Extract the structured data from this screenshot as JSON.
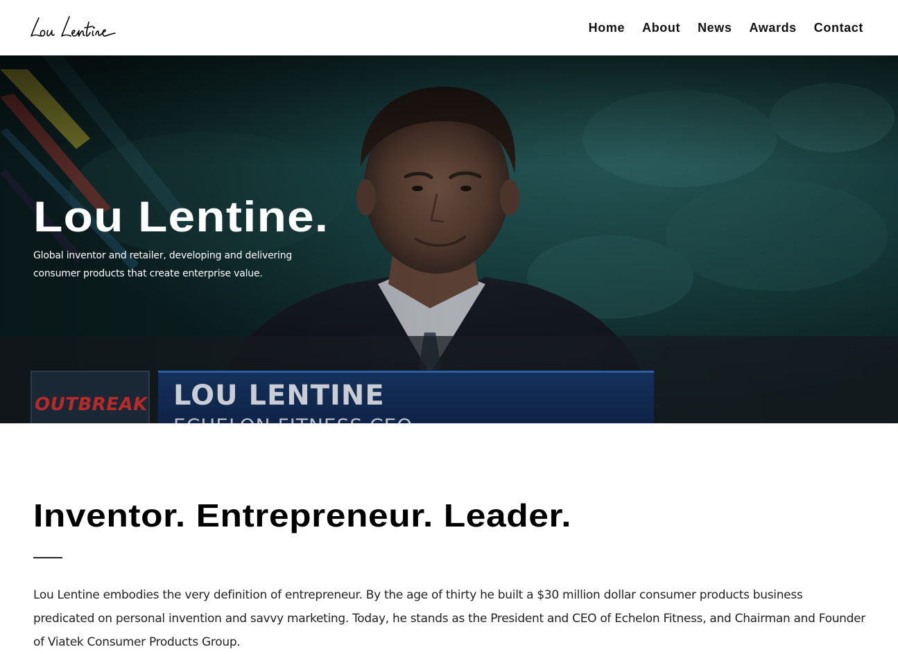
{
  "header": {
    "logo_text": "Lou Lentine",
    "nav": [
      {
        "label": "Home"
      },
      {
        "label": "About"
      },
      {
        "label": "News"
      },
      {
        "label": "Awards"
      },
      {
        "label": "Contact"
      }
    ]
  },
  "hero": {
    "title": "Lou Lentine.",
    "subtitle": "Global inventor and retailer, developing and delivering consumer products that create enterprise value.",
    "lower_third_name": "LOU LENTINE",
    "lower_third_role": "ECHELON FITNESS CEO",
    "outbreak_label": "OUTBREAK"
  },
  "about": {
    "heading": "Inventor. Entrepreneur. Leader.",
    "body": "Lou Lentine embodies the very definition of entrepreneur. By the age of thirty he built a $30 million dollar consumer products business predicated on personal invention and savvy marketing. Today, he stands as the President and CEO of Echelon Fitness, and Chairman and Founder of Viatek Consumer Products Group."
  },
  "colors": {
    "text": "#111111",
    "hero_teal": "#1f5a5a",
    "lower_third_blue": "#14305a",
    "outbreak_red": "#b82a2a"
  }
}
